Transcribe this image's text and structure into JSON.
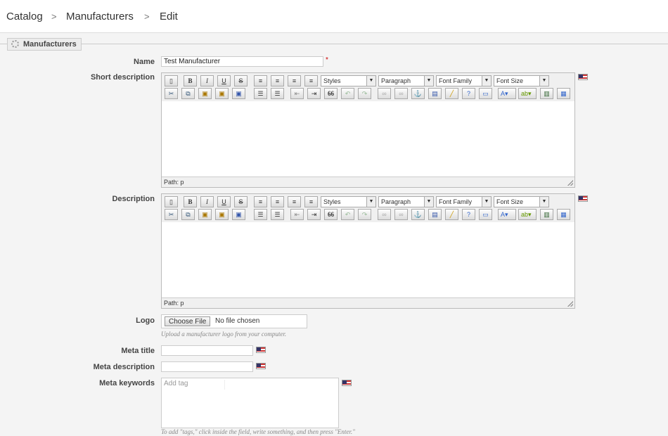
{
  "breadcrumb": [
    "Catalog",
    "Manufacturers",
    "Edit"
  ],
  "breadcrumb_sep": ">",
  "fieldset": {
    "legend": "Manufacturers"
  },
  "form": {
    "name": {
      "label": "Name",
      "value": "Test Manufacturer",
      "required_mark": "*"
    },
    "short_description": {
      "label": "Short description",
      "path": "Path: p"
    },
    "description": {
      "label": "Description",
      "path": "Path: p"
    },
    "logo": {
      "label": "Logo",
      "button": "Choose File",
      "status": "No file chosen",
      "hint": "Upload a manufacturer logo from your computer."
    },
    "meta_title": {
      "label": "Meta title",
      "value": ""
    },
    "meta_description": {
      "label": "Meta description",
      "value": ""
    },
    "meta_keywords": {
      "label": "Meta keywords",
      "placeholder": "Add tag",
      "hint": "To add \"tags,\" click inside the field, write something, and then press \"Enter.\""
    }
  },
  "toolbar": {
    "styles": "Styles",
    "format": "Paragraph",
    "font_family": "Font Family",
    "font_size": "Font Size",
    "bold": "B",
    "italic": "I",
    "underline": "U",
    "strike": "S",
    "blockquote": "66"
  },
  "icons": [
    "gear-icon",
    "flag-us-icon",
    "new-document-icon",
    "bold-icon",
    "italic-icon",
    "underline-icon",
    "strikethrough-icon",
    "align-left-icon",
    "align-center-icon",
    "align-right-icon",
    "align-justify-icon",
    "cut-icon",
    "copy-icon",
    "paste-icon",
    "paste-text-icon",
    "paste-word-icon",
    "bullet-list-icon",
    "numbered-list-icon",
    "outdent-icon",
    "indent-icon",
    "blockquote-icon",
    "undo-icon",
    "redo-icon",
    "link-icon",
    "unlink-icon",
    "anchor-icon",
    "image-icon",
    "cleanup-icon",
    "help-icon",
    "code-icon",
    "text-color-icon",
    "highlight-color-icon",
    "media-icon",
    "table-icon"
  ]
}
